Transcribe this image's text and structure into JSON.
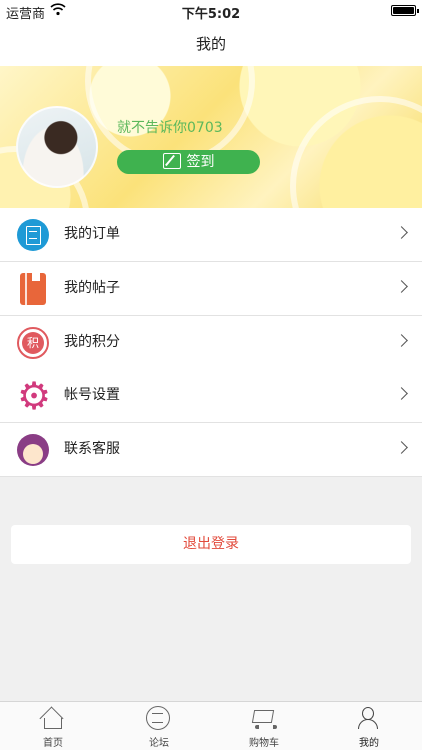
{
  "status_bar": {
    "carrier": "运营商",
    "time": "下午5:02"
  },
  "nav": {
    "title": "我的"
  },
  "profile": {
    "username": "就不告诉你0703",
    "checkin_label": "签到",
    "accent": "#3fb24f"
  },
  "menu_group_1": [
    {
      "label": "我的订单",
      "icon": "order-icon"
    },
    {
      "label": "我的帖子",
      "icon": "post-icon"
    },
    {
      "label": "我的积分",
      "icon": "points-icon",
      "icon_text": "积"
    }
  ],
  "menu_group_2": [
    {
      "label": "帐号设置",
      "icon": "gear-icon"
    },
    {
      "label": "联系客服",
      "icon": "customer-service-icon"
    }
  ],
  "logout": {
    "label": "退出登录",
    "color": "#e24a3b"
  },
  "tabbar": [
    {
      "label": "首页",
      "icon": "home-icon"
    },
    {
      "label": "论坛",
      "icon": "forum-icon"
    },
    {
      "label": "购物车",
      "icon": "cart-icon"
    },
    {
      "label": "我的",
      "icon": "profile-icon"
    }
  ]
}
